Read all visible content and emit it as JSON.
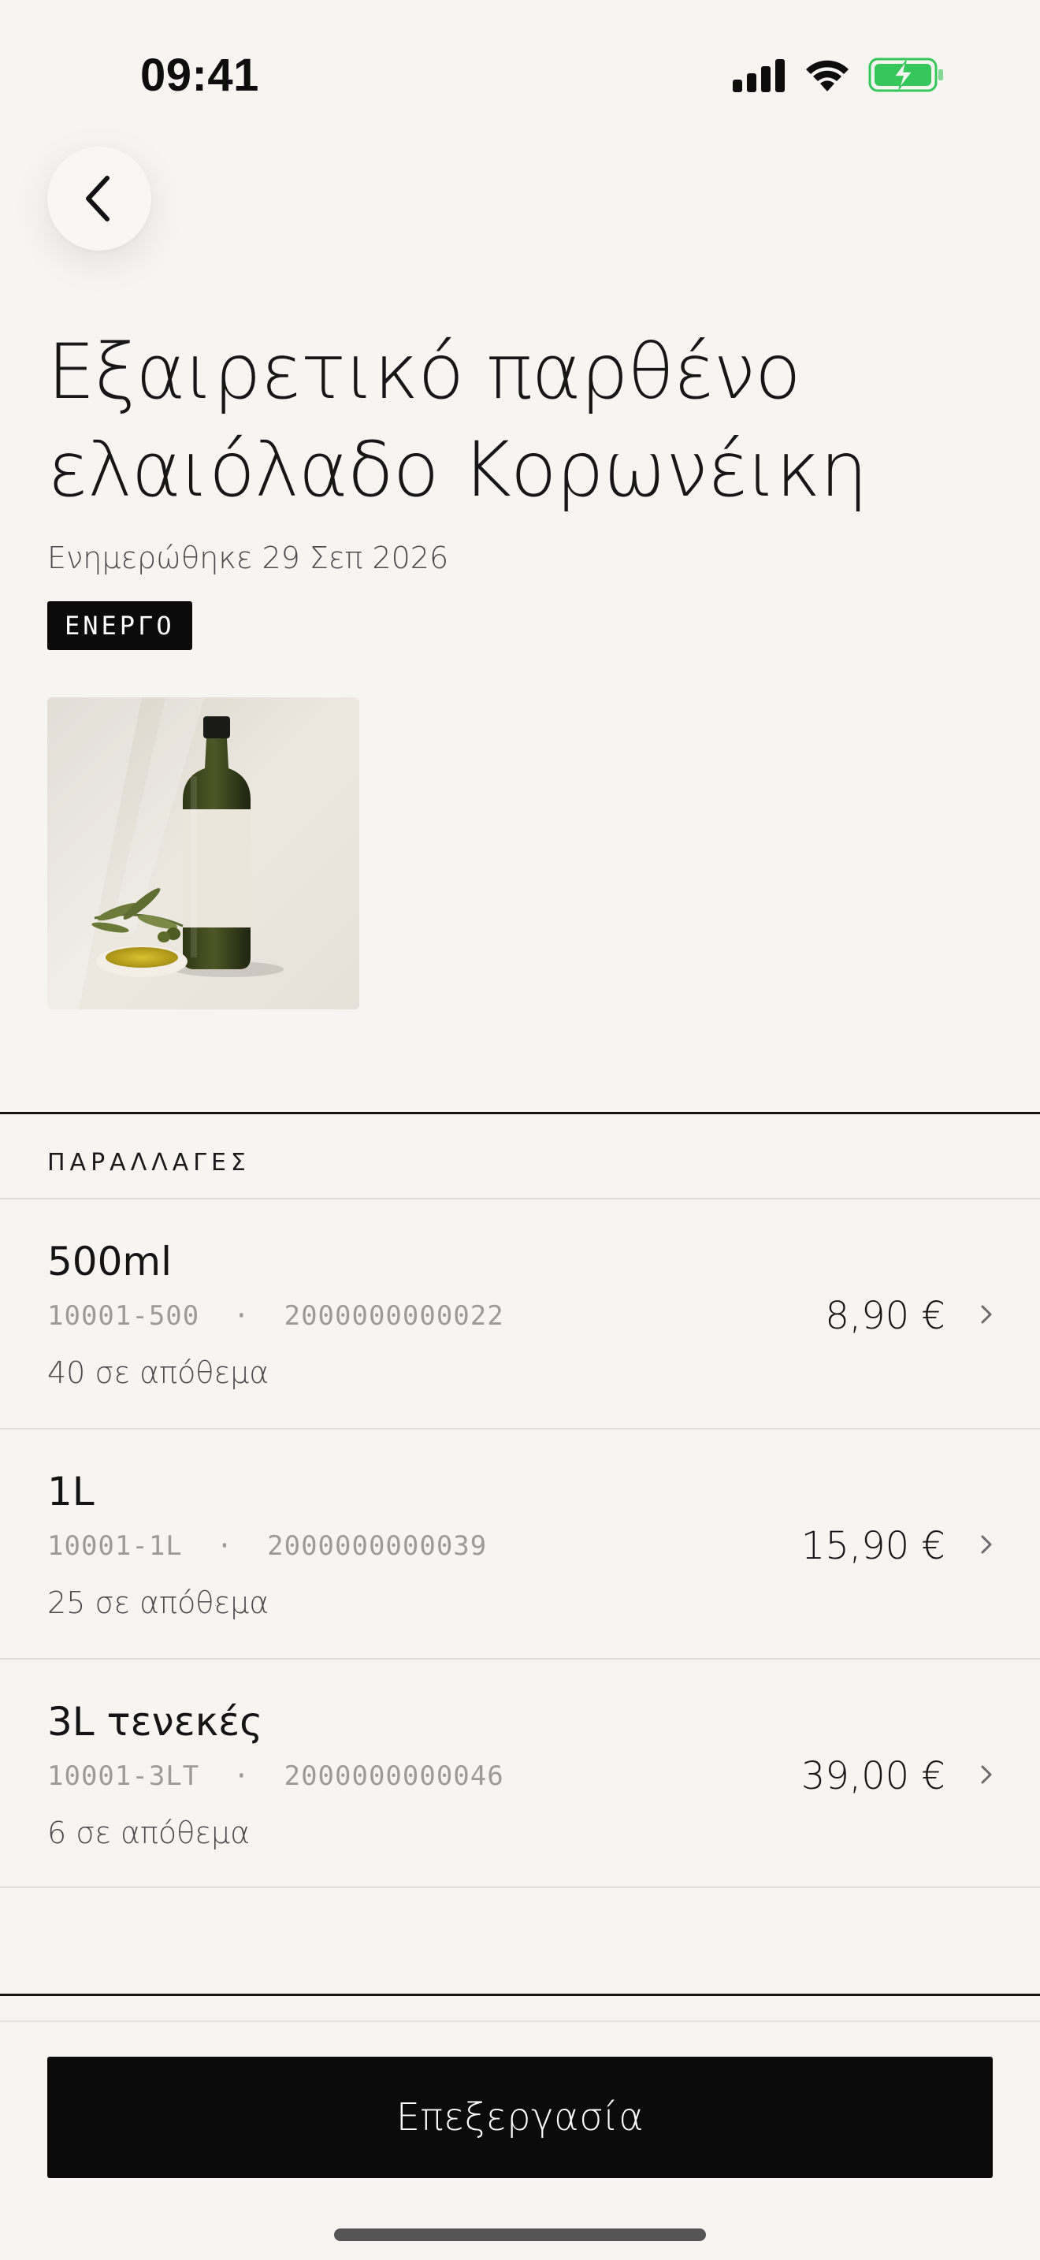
{
  "status_bar": {
    "time": "09:41",
    "icons": [
      "cellular-signal-icon",
      "wifi-icon",
      "battery-charging-icon"
    ]
  },
  "nav": {
    "back_icon": "chevron-left-icon"
  },
  "product": {
    "title": "Εξαιρετικό παρθένο ελαιόλαδο Κορωνέικη",
    "updated": "Ενημερώθηκε 29 Σεπ 2026",
    "status": "ΕΝΕΡΓΟ",
    "image_alt": "olive-oil-bottle-photo"
  },
  "variants_section": {
    "label": "ΠΑΡΑΛΛΑΓΕΣ",
    "items": [
      {
        "name": "500ml",
        "sku": "10001-500",
        "barcode": "2000000000022",
        "stock": "40 σε απόθεμα",
        "price": "8,90 €"
      },
      {
        "name": "1L",
        "sku": "10001-1L",
        "barcode": "2000000000039",
        "stock": "25 σε απόθεμα",
        "price": "15,90 €"
      },
      {
        "name": "3L τενεκές",
        "sku": "10001-3LT",
        "barcode": "2000000000046",
        "stock": "6 σε απόθεμα",
        "price": "39,00 €"
      }
    ]
  },
  "actions": {
    "edit_label": "Επεξεργασία"
  },
  "colors": {
    "background": "#f6f5f2",
    "primary": "#0b0b0b",
    "battery": "#35c759",
    "muted_text": "#9c9b98"
  }
}
